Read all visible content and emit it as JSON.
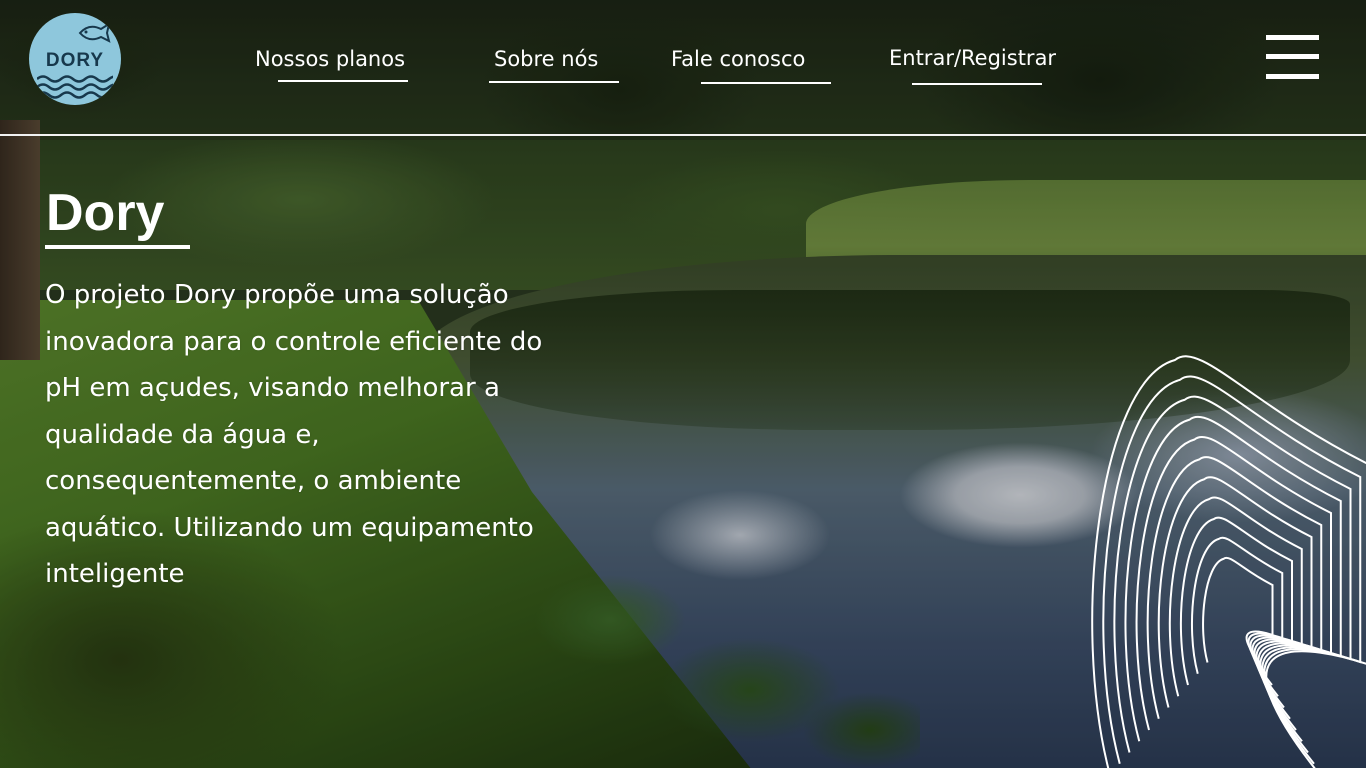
{
  "brand": {
    "logo_text": "DORY"
  },
  "nav": {
    "items": [
      {
        "label": "Nossos planos"
      },
      {
        "label": "Sobre nós"
      },
      {
        "label": "Fale conosco"
      },
      {
        "label": "Entrar/Registrar"
      }
    ]
  },
  "menu": {
    "icon": "hamburger-menu-icon"
  },
  "hero": {
    "title": "Dory",
    "description": "O projeto Dory propõe uma solução inovadora para o controle eficiente do pH em açudes, visando melhorar a qualidade da água e, consequentemente, o ambiente aquático. Utilizando um equipamento inteligente"
  },
  "colors": {
    "text": "#ffffff",
    "logo_bg": "#8ec7dc",
    "logo_ink": "#17384c"
  }
}
